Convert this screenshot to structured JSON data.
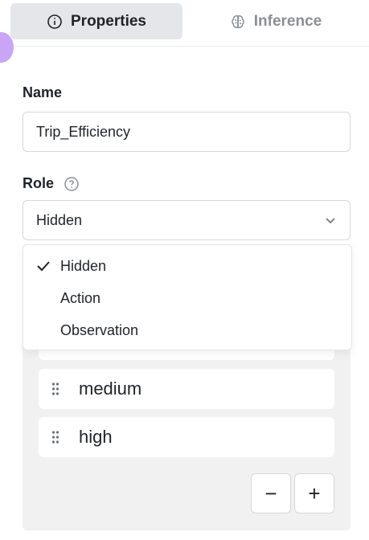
{
  "tabs": [
    {
      "label": "Properties",
      "icon": "info-icon",
      "active": true
    },
    {
      "label": "Inference",
      "icon": "brain-icon",
      "active": false
    }
  ],
  "fields": {
    "name_label": "Name",
    "name_value": "Trip_Efficiency",
    "role_label": "Role",
    "role_value": "Hidden"
  },
  "role_options": [
    {
      "label": "Hidden",
      "selected": true
    },
    {
      "label": "Action",
      "selected": false
    },
    {
      "label": "Observation",
      "selected": false
    }
  ],
  "states": [
    "",
    "medium",
    "high"
  ],
  "buttons": {
    "remove": "−",
    "add": "+"
  },
  "colors": {
    "accent_purple": "#c8a6f5",
    "active_tab_bg": "#e4e6ea",
    "panel_bg": "#f1f1f2"
  }
}
